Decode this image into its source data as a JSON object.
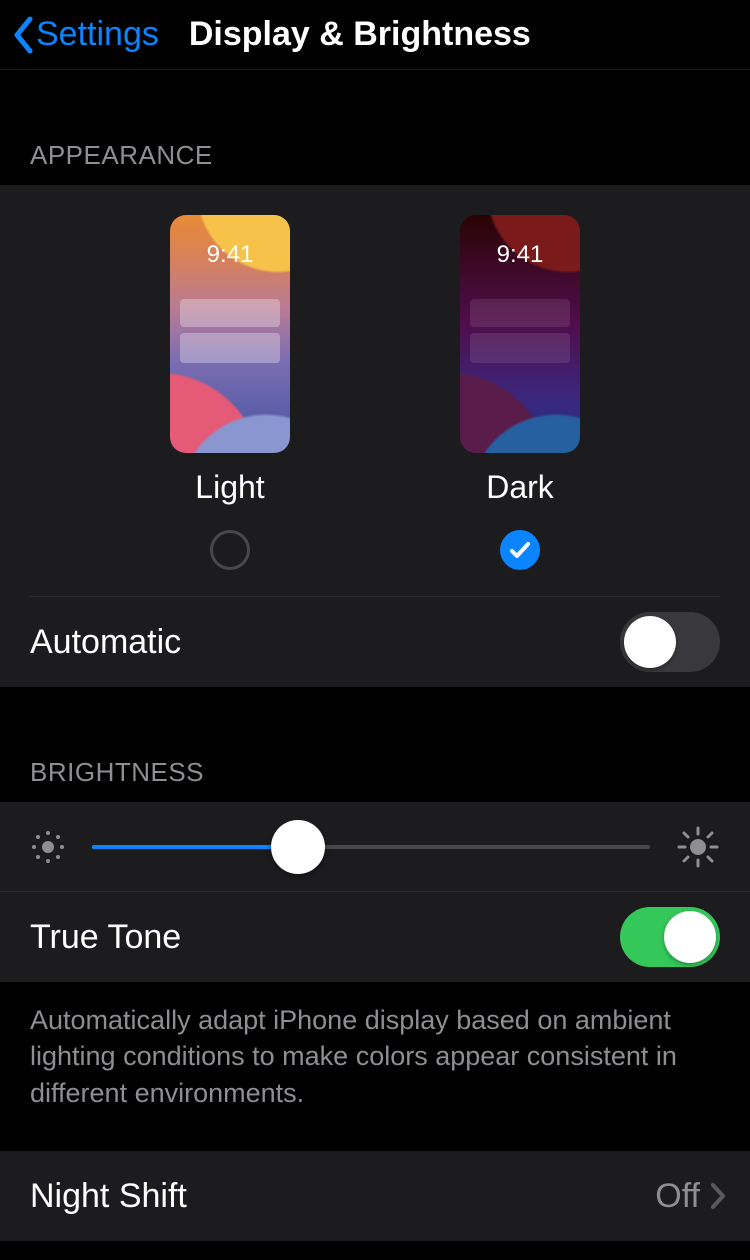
{
  "nav": {
    "back_label": "Settings",
    "title": "Display & Brightness"
  },
  "appearance": {
    "header": "Appearance",
    "thumb_time": "9:41",
    "light": {
      "label": "Light",
      "selected": false
    },
    "dark": {
      "label": "Dark",
      "selected": true
    },
    "automatic": {
      "label": "Automatic",
      "value": false
    }
  },
  "brightness": {
    "header": "Brightness",
    "value_percent": 37,
    "true_tone": {
      "label": "True Tone",
      "value": true
    },
    "footer": "Automatically adapt iPhone display based on ambient lighting conditions to make colors appear consistent in different environments."
  },
  "night_shift": {
    "label": "Night Shift",
    "value": "Off"
  }
}
